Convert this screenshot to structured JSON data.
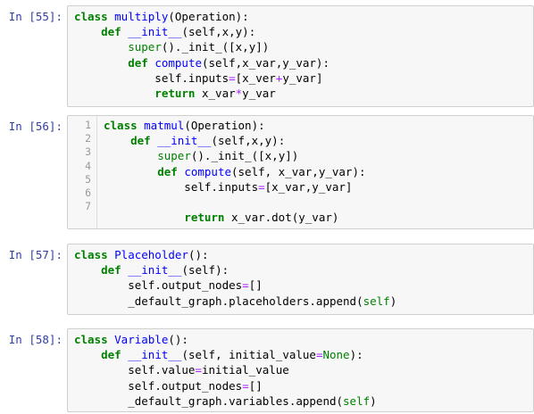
{
  "cells": [
    {
      "prompt": "In [55]:",
      "lines": [
        [
          {
            "t": "class ",
            "c": "kw"
          },
          {
            "t": "multiply",
            "c": "nm"
          },
          {
            "t": "(Operation):",
            "c": "tx"
          }
        ],
        [
          {
            "t": "    def ",
            "c": "kw"
          },
          {
            "t": "__init__",
            "c": "nm"
          },
          {
            "t": "(self,x,y):",
            "c": "tx"
          }
        ],
        [
          {
            "t": "        ",
            "c": "tx"
          },
          {
            "t": "super",
            "c": "bi"
          },
          {
            "t": "().",
            "c": "tx"
          },
          {
            "t": "_init_",
            "c": "tx"
          },
          {
            "t": "([x,y])",
            "c": "tx"
          }
        ],
        [
          {
            "t": "        def ",
            "c": "kw"
          },
          {
            "t": "compute",
            "c": "nm"
          },
          {
            "t": "(self,x_var,y_var):",
            "c": "tx"
          }
        ],
        [
          {
            "t": "            self.inputs",
            "c": "tx"
          },
          {
            "t": "=",
            "c": "op"
          },
          {
            "t": "[x_ver",
            "c": "tx"
          },
          {
            "t": "+",
            "c": "op"
          },
          {
            "t": "y_var]",
            "c": "tx"
          }
        ],
        [
          {
            "t": "            return ",
            "c": "kw"
          },
          {
            "t": "x_var",
            "c": "tx"
          },
          {
            "t": "*",
            "c": "op"
          },
          {
            "t": "y_var",
            "c": "tx"
          }
        ]
      ]
    },
    {
      "prompt": "In [56]:",
      "line_numbers": [
        "1",
        "2",
        "3",
        "4",
        "5",
        "6",
        "7"
      ],
      "lines": [
        [
          {
            "t": "class ",
            "c": "kw"
          },
          {
            "t": "matmul",
            "c": "nm"
          },
          {
            "t": "(Operation):",
            "c": "tx"
          }
        ],
        [
          {
            "t": "    def ",
            "c": "kw"
          },
          {
            "t": "__init__",
            "c": "nm"
          },
          {
            "t": "(self,x,y):",
            "c": "tx"
          }
        ],
        [
          {
            "t": "        ",
            "c": "tx"
          },
          {
            "t": "super",
            "c": "bi"
          },
          {
            "t": "().",
            "c": "tx"
          },
          {
            "t": "_init_",
            "c": "tx"
          },
          {
            "t": "([x,y])",
            "c": "tx"
          }
        ],
        [
          {
            "t": "        def ",
            "c": "kw"
          },
          {
            "t": "compute",
            "c": "nm"
          },
          {
            "t": "(self, x_var,y_var):",
            "c": "tx"
          }
        ],
        [
          {
            "t": "            self.inputs",
            "c": "tx"
          },
          {
            "t": "=",
            "c": "op"
          },
          {
            "t": "[x_var,y_var]",
            "c": "tx"
          }
        ],
        [
          {
            "t": "",
            "c": "tx"
          }
        ],
        [
          {
            "t": "            return ",
            "c": "kw"
          },
          {
            "t": "x_var.dot(y_var)",
            "c": "tx"
          }
        ]
      ]
    },
    {
      "prompt": "In [57]:",
      "lines": [
        [
          {
            "t": "class ",
            "c": "kw"
          },
          {
            "t": "Placeholder",
            "c": "nm"
          },
          {
            "t": "():",
            "c": "tx"
          }
        ],
        [
          {
            "t": "    def ",
            "c": "kw"
          },
          {
            "t": "__init__",
            "c": "nm"
          },
          {
            "t": "(self):",
            "c": "tx"
          }
        ],
        [
          {
            "t": "        self.output_nodes",
            "c": "tx"
          },
          {
            "t": "=",
            "c": "op"
          },
          {
            "t": "[]",
            "c": "tx"
          }
        ],
        [
          {
            "t": "        _default_graph.placeholders.append(",
            "c": "tx"
          },
          {
            "t": "self",
            "c": "bi"
          },
          {
            "t": ")",
            "c": "tx"
          }
        ]
      ]
    },
    {
      "prompt": "In [58]:",
      "lines": [
        [
          {
            "t": "class ",
            "c": "kw"
          },
          {
            "t": "Variable",
            "c": "nm"
          },
          {
            "t": "():",
            "c": "tx"
          }
        ],
        [
          {
            "t": "    def ",
            "c": "kw"
          },
          {
            "t": "__init__",
            "c": "nm"
          },
          {
            "t": "(self, initial_value",
            "c": "tx"
          },
          {
            "t": "=",
            "c": "op"
          },
          {
            "t": "None",
            "c": "bi"
          },
          {
            "t": "):",
            "c": "tx"
          }
        ],
        [
          {
            "t": "        self.value",
            "c": "tx"
          },
          {
            "t": "=",
            "c": "op"
          },
          {
            "t": "initial_value",
            "c": "tx"
          }
        ],
        [
          {
            "t": "        self.output_nodes",
            "c": "tx"
          },
          {
            "t": "=",
            "c": "op"
          },
          {
            "t": "[]",
            "c": "tx"
          }
        ],
        [
          {
            "t": "        _default_graph.variables.append(",
            "c": "tx"
          },
          {
            "t": "self",
            "c": "bi"
          },
          {
            "t": ")",
            "c": "tx"
          }
        ]
      ]
    }
  ]
}
